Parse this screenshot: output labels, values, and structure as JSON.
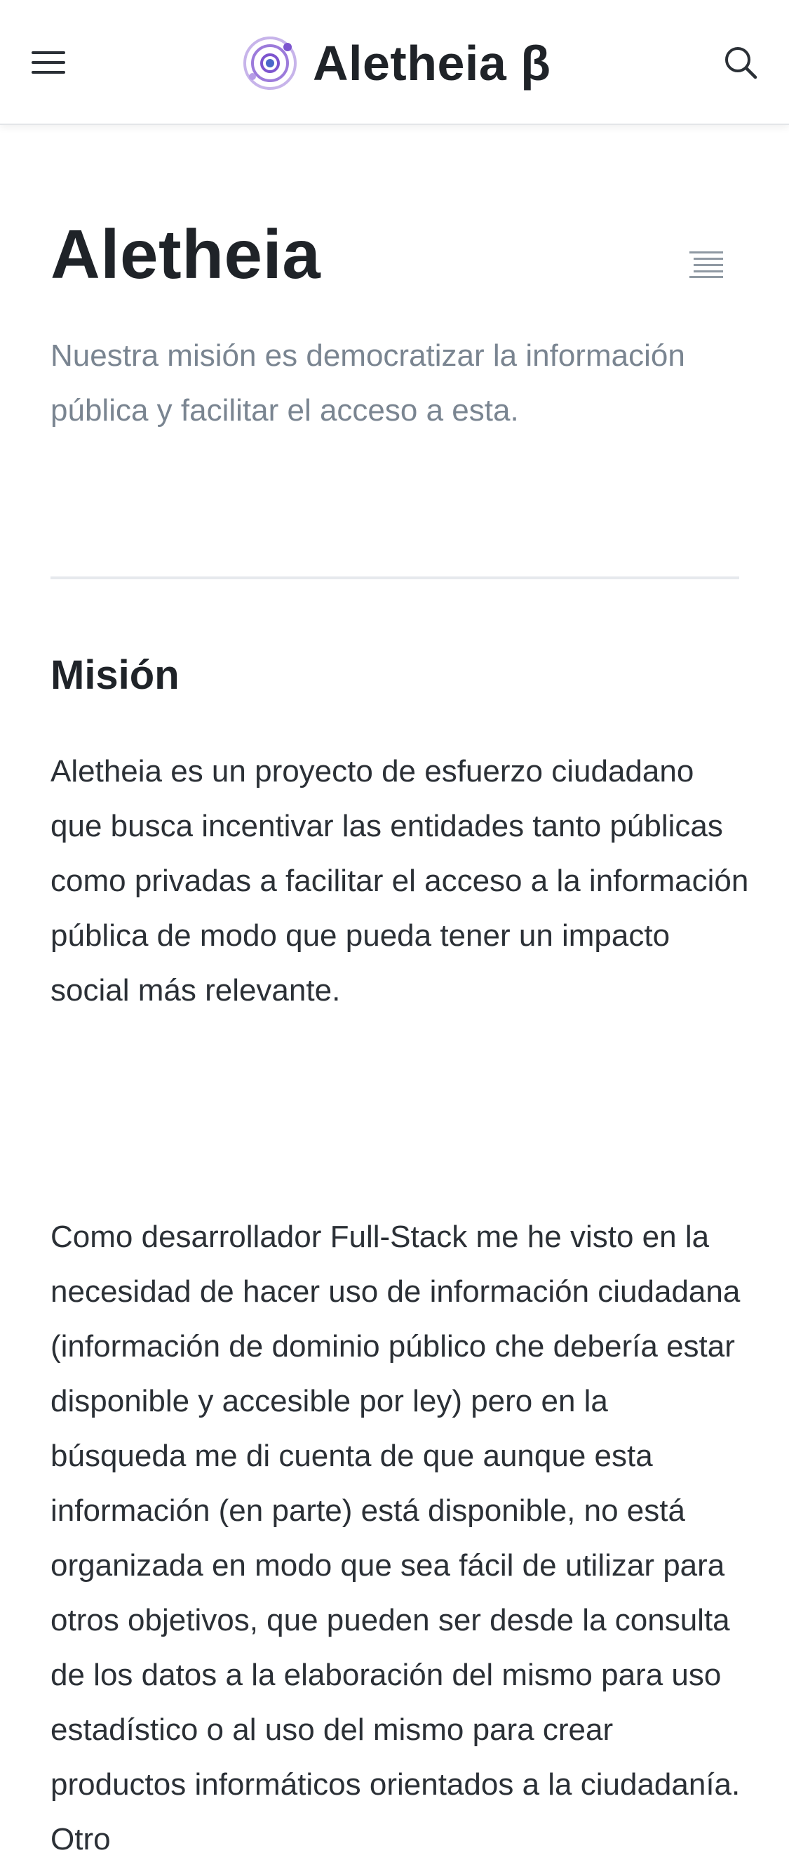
{
  "header": {
    "menu_icon": "hamburger-menu-icon",
    "logo_icon": "orbit-logo-icon",
    "brand_title": "Aletheia β",
    "search_icon": "search-icon",
    "accent_color": "#8a5fd6"
  },
  "page": {
    "title": "Aletheia",
    "toc_icon": "table-of-contents-icon",
    "subtitle": "Nuestra misión es democratizar la información pública y facilitar el acceso a esta."
  },
  "section": {
    "heading": "Misión",
    "paragraphs": [
      "Aletheia es un proyecto de esfuerzo ciudadano que busca incentivar las entidades tanto públicas como privadas a facilitar el acceso a la información pública de modo que pueda tener un impacto social más relevante.",
      "Como desarrollador Full-Stack me he visto en la necesidad de hacer uso de información ciudadana (información de dominio público che debería estar disponible y accesible por ley) pero en la búsqueda me di cuenta de que aunque esta información (en parte) está disponible, no está organizada en modo que sea fácil de utilizar para otros objetivos, que pueden ser desde la consulta de los datos a la elaboración del mismo para uso estadístico o al uso del mismo para crear productos informáticos orientados a la ciudadanía. Otro"
    ]
  }
}
